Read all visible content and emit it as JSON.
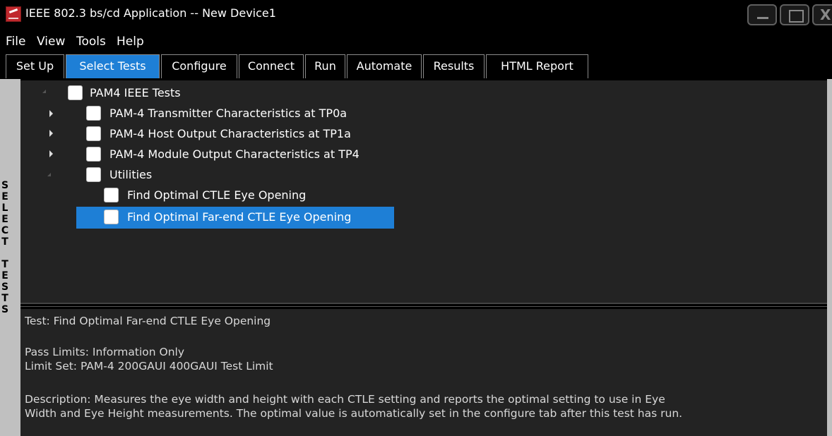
{
  "window": {
    "title": "IEEE 802.3 bs/cd Application -- New Device1"
  },
  "menu": {
    "items": [
      "File",
      "View",
      "Tools",
      "Help"
    ]
  },
  "tabs": [
    {
      "label": "Set Up",
      "active": false
    },
    {
      "label": "Select Tests",
      "active": true
    },
    {
      "label": "Configure",
      "active": false
    },
    {
      "label": "Connect",
      "active": false
    },
    {
      "label": "Run",
      "active": false
    },
    {
      "label": "Automate",
      "active": false
    },
    {
      "label": "Results",
      "active": false
    },
    {
      "label": "HTML Report",
      "active": false
    }
  ],
  "side_label": "SELECT TESTS",
  "tree": {
    "root": {
      "label": "PAM4 IEEE Tests",
      "checked": false,
      "expanded": true
    },
    "groups": [
      {
        "label": "PAM-4 Transmitter Characteristics at TP0a",
        "checked": false,
        "expanded": false
      },
      {
        "label": "PAM-4 Host Output Characteristics at TP1a",
        "checked": false,
        "expanded": false
      },
      {
        "label": "PAM-4 Module Output Characteristics at TP4",
        "checked": false,
        "expanded": false
      },
      {
        "label": "Utilities",
        "checked": false,
        "expanded": true
      }
    ],
    "utilities": [
      {
        "label": "Find Optimal CTLE Eye Opening",
        "checked": false,
        "selected": false
      },
      {
        "label": "Find Optimal Far-end CTLE Eye Opening",
        "checked": false,
        "selected": true
      }
    ]
  },
  "details": {
    "test": "Test: Find Optimal Far-end CTLE Eye Opening",
    "pass_limits": "Pass Limits: Information Only",
    "limit_set": "Limit Set: PAM-4 200GAUI 400GAUI Test Limit",
    "description_line1": "Description: Measures the eye width and height with each CTLE setting and reports the optimal setting to use in Eye",
    "description_line2": "Width and Eye Height measurements. The optimal value is automatically set in the configure tab after this test has run."
  },
  "colors": {
    "accent": "#1e7fd6",
    "panel": "#232323",
    "frame": "#c0c0c0"
  }
}
